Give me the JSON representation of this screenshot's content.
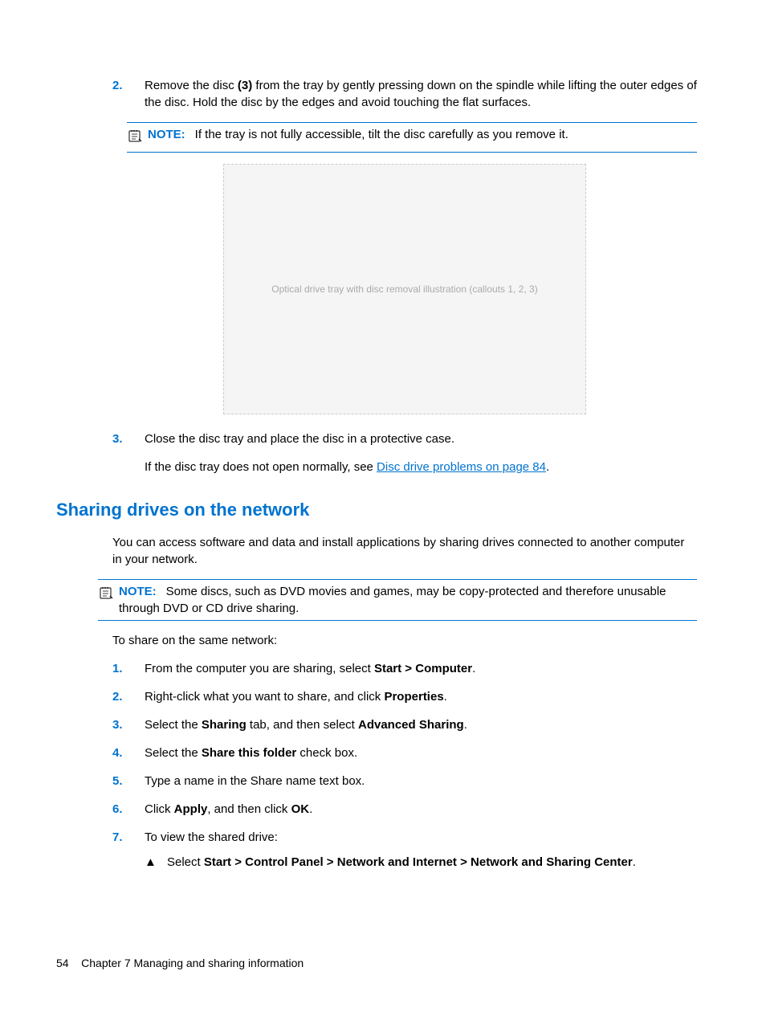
{
  "step2": {
    "num": "2.",
    "text_before": "Remove the disc ",
    "bold1": "(3)",
    "text_after": " from the tray by gently pressing down on the spindle while lifting the outer edges of the disc. Hold the disc by the edges and avoid touching the flat surfaces."
  },
  "note1": {
    "label": "NOTE:",
    "text": "If the tray is not fully accessible, tilt the disc carefully as you remove it."
  },
  "image_alt": "Optical drive tray with disc removal illustration (callouts 1, 2, 3)",
  "step3": {
    "num": "3.",
    "text": "Close the disc tray and place the disc in a protective case."
  },
  "tray_fail": {
    "before": "If the disc tray does not open normally, see ",
    "link": "Disc drive problems on page 84",
    "after": "."
  },
  "heading": "Sharing drives on the network",
  "sharing_intro": "You can access software and data and install applications by sharing drives connected to another computer in your network.",
  "note2": {
    "label": "NOTE:",
    "text": "Some discs, such as DVD movies and games, may be copy-protected and therefore unusable through DVD or CD drive sharing."
  },
  "share_lead": "To share on the same network:",
  "steps": {
    "s1": {
      "num": "1.",
      "before": "From the computer you are sharing, select ",
      "b1": "Start > Computer",
      "after": "."
    },
    "s2": {
      "num": "2.",
      "before": "Right-click what you want to share, and click ",
      "b1": "Properties",
      "after": "."
    },
    "s3": {
      "num": "3.",
      "before": "Select the ",
      "b1": "Sharing",
      "mid": " tab, and then select ",
      "b2": "Advanced Sharing",
      "after": "."
    },
    "s4": {
      "num": "4.",
      "before": "Select the ",
      "b1": "Share this folder",
      "after": " check box."
    },
    "s5": {
      "num": "5.",
      "text": "Type a name in the Share name text box."
    },
    "s6": {
      "num": "6.",
      "before": "Click ",
      "b1": "Apply",
      "mid": ", and then click ",
      "b2": "OK",
      "after": "."
    },
    "s7": {
      "num": "7.",
      "text": "To view the shared drive:"
    }
  },
  "sub": {
    "marker": "▲",
    "before": "Select ",
    "b1": "Start > Control Panel > Network and Internet > Network and Sharing Center",
    "after": "."
  },
  "footer": {
    "page": "54",
    "chapter": "Chapter 7   Managing and sharing information"
  }
}
